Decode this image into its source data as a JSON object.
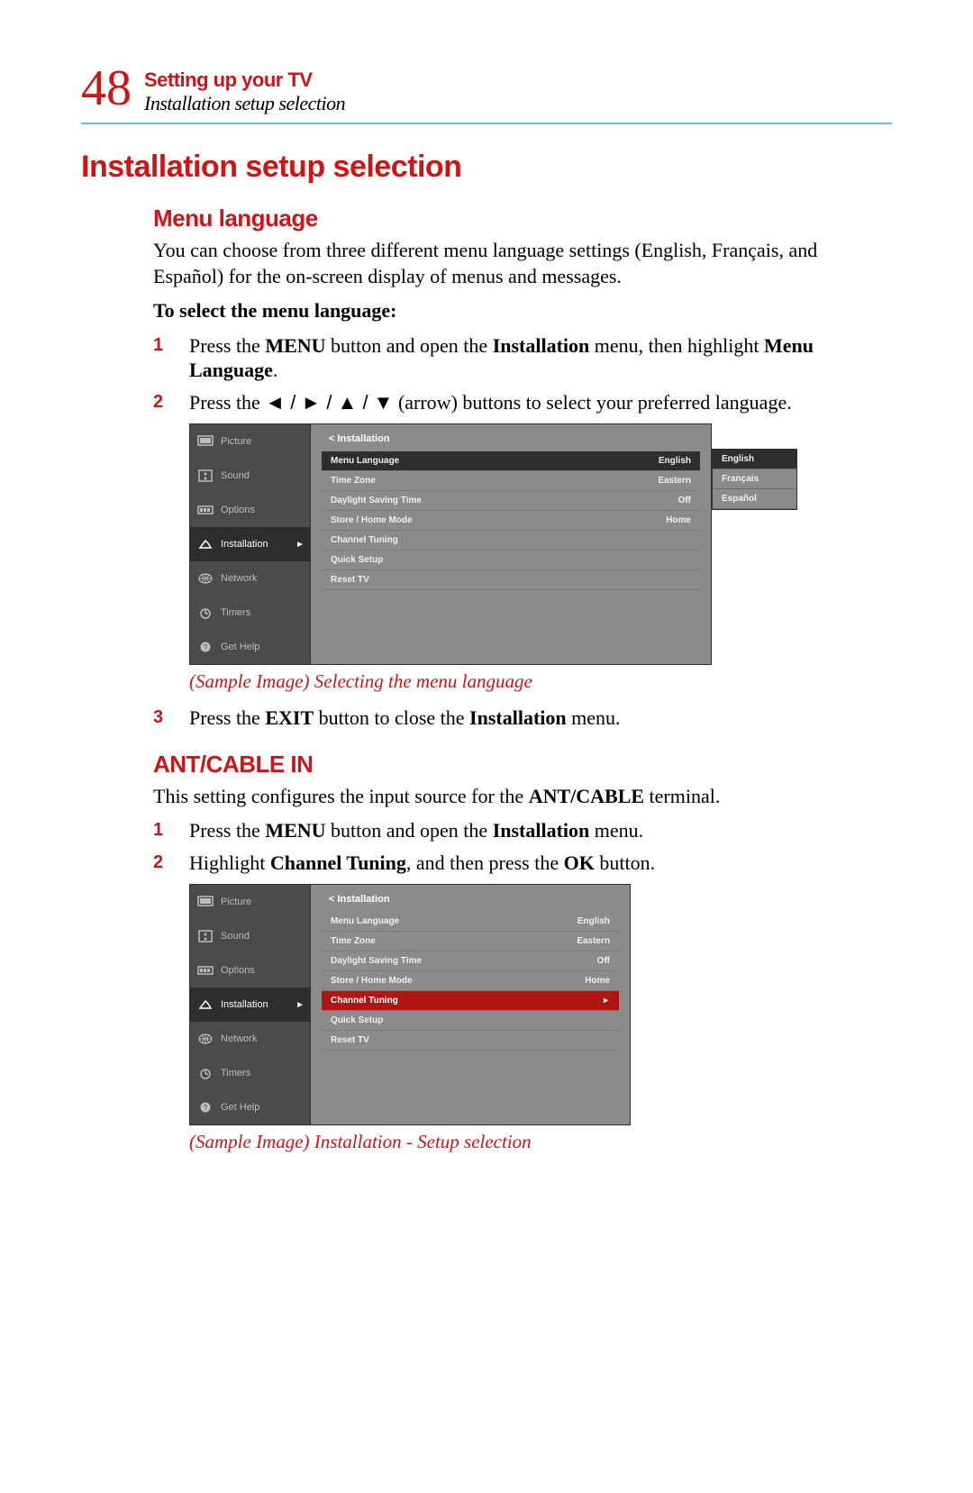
{
  "header": {
    "page_number": "48",
    "chapter": "Setting up your TV",
    "section": "Installation setup selection"
  },
  "h1": "Installation setup selection",
  "menu_language": {
    "heading": "Menu language",
    "intro": "You can choose from three different menu language settings (English, Français, and Español) for the on-screen display of menus and messages.",
    "subhead": "To select the menu language:",
    "steps": {
      "s1_a": "Press the ",
      "s1_b": "MENU",
      "s1_c": " button and open the ",
      "s1_d": "Installation",
      "s1_e": " menu, then highlight ",
      "s1_f": "Menu Language",
      "s1_g": ".",
      "s2_a": "Press the ",
      "s2_arrows": "◄ / ► / ▲ / ▼",
      "s2_b": " (arrow) buttons to select your preferred language.",
      "s3_a": "Press the ",
      "s3_b": "EXIT",
      "s3_c": " button to close the ",
      "s3_d": "Installation",
      "s3_e": " menu."
    },
    "caption": "(Sample Image) Selecting the menu language"
  },
  "ant_cable": {
    "heading": "ANT/CABLE IN",
    "intro_a": "This setting configures the input source for the ",
    "intro_b": "ANT/CABLE",
    "intro_c": " terminal.",
    "steps": {
      "s1_a": "Press the ",
      "s1_b": "MENU",
      "s1_c": " button and open the ",
      "s1_d": "Installation",
      "s1_e": " menu.",
      "s2_a": "Highlight ",
      "s2_b": "Channel Tuning",
      "s2_c": ", and then press the ",
      "s2_d": "OK",
      "s2_e": " button."
    },
    "caption": "(Sample Image) Installation - Setup selection"
  },
  "tv_menu": {
    "sidebar": [
      "Picture",
      "Sound",
      "Options",
      "Installation",
      "Network",
      "Timers",
      "Get Help"
    ],
    "panel_title": "< Installation",
    "rows": [
      {
        "label": "Menu Language",
        "value": "English"
      },
      {
        "label": "Time Zone",
        "value": "Eastern"
      },
      {
        "label": "Daylight Saving Time",
        "value": "Off"
      },
      {
        "label": "Store / Home Mode",
        "value": "Home"
      },
      {
        "label": "Channel Tuning",
        "value": ""
      },
      {
        "label": "Quick Setup",
        "value": ""
      },
      {
        "label": "Reset TV",
        "value": ""
      }
    ],
    "popup": [
      "English",
      "Français",
      "Español"
    ]
  },
  "step_nums": {
    "n1": "1",
    "n2": "2",
    "n3": "3"
  }
}
